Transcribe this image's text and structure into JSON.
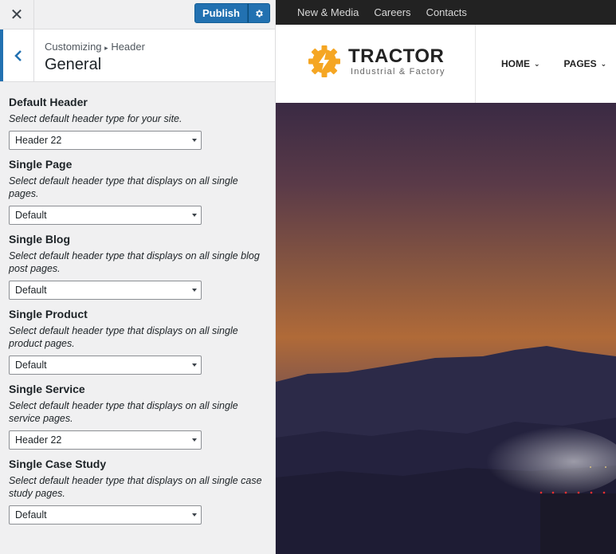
{
  "topbar": {
    "close_icon": "close-icon",
    "publish_label": "Publish",
    "settings_icon": "gear-icon"
  },
  "section": {
    "breadcrumb_parent": "Customizing",
    "breadcrumb_separator": "▸",
    "breadcrumb_child": "Header",
    "title": "General",
    "back_icon": "chevron-left-icon"
  },
  "controls": [
    {
      "title": "Default Header",
      "desc": "Select default header type for your site.",
      "value": "Header 22"
    },
    {
      "title": "Single Page",
      "desc": "Select default header type that displays on all single pages.",
      "value": "Default"
    },
    {
      "title": "Single Blog",
      "desc": "Select default header type that displays on all single blog post pages.",
      "value": "Default"
    },
    {
      "title": "Single Product",
      "desc": "Select default header type that displays on all single product pages.",
      "value": "Default"
    },
    {
      "title": "Single Service",
      "desc": "Select default header type that displays on all single service pages.",
      "value": "Header 22"
    },
    {
      "title": "Single Case Study",
      "desc": "Select default header type that displays on all single case study pages.",
      "value": "Default"
    }
  ],
  "preview": {
    "top_nav": [
      "New & Media",
      "Careers",
      "Contacts"
    ],
    "logo_name": "TRACTOR",
    "logo_tagline": "Industrial & Factory",
    "main_nav": [
      "HOME",
      "PAGES"
    ],
    "accent_color": "#f5a623",
    "brand_blue": "#2271b1"
  }
}
